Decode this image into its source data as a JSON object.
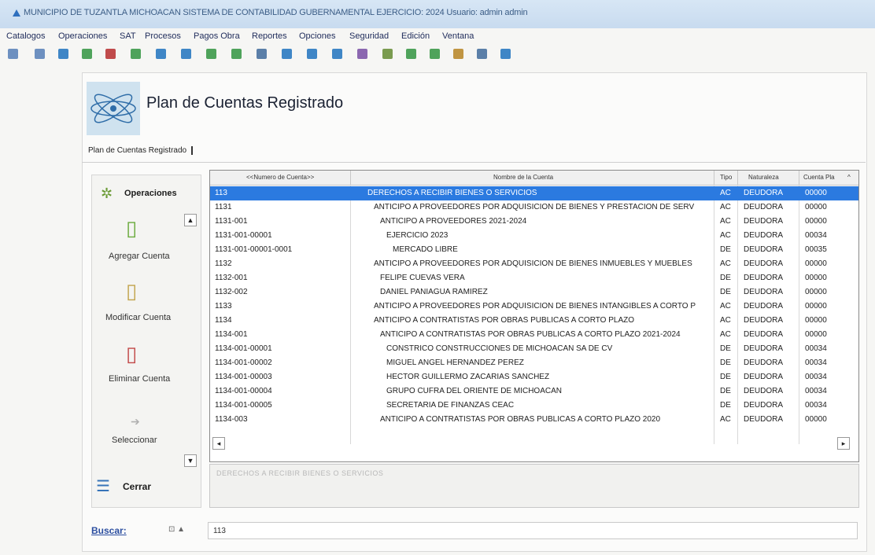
{
  "window": {
    "title": "MUNICIPIO DE TUZANTLA MICHOACAN SISTEMA DE CONTABILIDAD GUBERNAMENTAL EJERCICIO: 2024 Usuario: admin admin"
  },
  "menu": [
    "Catalogos",
    "Operaciones",
    "SAT",
    "Procesos",
    "Pagos Obra",
    "Reportes",
    "Opciones",
    "Seguridad",
    "Edición",
    "Ventana"
  ],
  "page": {
    "title": "Plan de Cuentas Registrado",
    "tab": "Plan de Cuentas Registrado"
  },
  "operations": {
    "header": "Operaciones",
    "items": [
      {
        "label": "Agregar Cuenta",
        "icon": "add-account-icon"
      },
      {
        "label": "Modificar Cuenta",
        "icon": "edit-account-icon"
      },
      {
        "label": "Eliminar Cuenta",
        "icon": "delete-account-icon"
      },
      {
        "label": "Seleccionar",
        "icon": "arrow-icon"
      }
    ],
    "close_label": "Cerrar"
  },
  "grid": {
    "columns": [
      "<<Numero de Cuenta>>",
      "Nombre de la Cuenta",
      "Tipo",
      "Naturaleza",
      "Cuenta Pla"
    ],
    "rows": [
      [
        "113",
        "DERECHOS A RECIBIR BIENES O SERVICIOS",
        "AC",
        "DEUDORA",
        "00000"
      ],
      [
        "1131",
        "ANTICIPO A PROVEEDORES POR ADQUISICION DE BIENES Y PRESTACION DE SERV",
        "AC",
        "DEUDORA",
        "00000"
      ],
      [
        "1131-001",
        "ANTICIPO A PROVEEDORES 2021-2024",
        "AC",
        "DEUDORA",
        "00000"
      ],
      [
        "1131-001-00001",
        "EJERCICIO 2023",
        "AC",
        "DEUDORA",
        "00034"
      ],
      [
        "1131-001-00001-0001",
        "MERCADO LIBRE",
        "DE",
        "DEUDORA",
        "00035"
      ],
      [
        "1132",
        "ANTICIPO A PROVEEDORES POR ADQUISICION DE BIENES INMUEBLES Y MUEBLES",
        "AC",
        "DEUDORA",
        "00000"
      ],
      [
        "1132-001",
        "FELIPE CUEVAS VERA",
        "DE",
        "DEUDORA",
        "00000"
      ],
      [
        "1132-002",
        "DANIEL PANIAGUA RAMIREZ",
        "DE",
        "DEUDORA",
        "00000"
      ],
      [
        "1133",
        "ANTICIPO A PROVEEDORES POR ADQUISICION DE BIENES INTANGIBLES A CORTO P",
        "AC",
        "DEUDORA",
        "00000"
      ],
      [
        "1134",
        "ANTICIPO A CONTRATISTAS POR OBRAS PUBLICAS A CORTO PLAZO",
        "AC",
        "DEUDORA",
        "00000"
      ],
      [
        "1134-001",
        "ANTICIPO A CONTRATISTAS POR OBRAS PUBLICAS A CORTO PLAZO 2021-2024",
        "AC",
        "DEUDORA",
        "00000"
      ],
      [
        "1134-001-00001",
        "CONSTRICO  CONSTRUCCIONES DE MICHOACAN SA DE CV",
        "DE",
        "DEUDORA",
        "00034"
      ],
      [
        "1134-001-00002",
        "MIGUEL ANGEL HERNANDEZ PEREZ",
        "DE",
        "DEUDORA",
        "00034"
      ],
      [
        "1134-001-00003",
        "HECTOR GUILLERMO ZACARIAS SANCHEZ",
        "DE",
        "DEUDORA",
        "00034"
      ],
      [
        "1134-001-00004",
        "GRUPO CUFRA DEL ORIENTE DE MICHOACAN",
        "DE",
        "DEUDORA",
        "00034"
      ],
      [
        "1134-001-00005",
        "SECRETARIA DE FINANZAS CEAC",
        "DE",
        "DEUDORA",
        "00034"
      ],
      [
        "1134-003",
        "ANTICIPO A CONTRATISTAS POR OBRAS PUBLICAS A CORTO PLAZO 2020",
        "AC",
        "DEUDORA",
        "00000"
      ]
    ]
  },
  "description": "DERECHOS A RECIBIR BIENES O SERVICIOS",
  "search": {
    "label": "Buscar:",
    "value": "113"
  }
}
